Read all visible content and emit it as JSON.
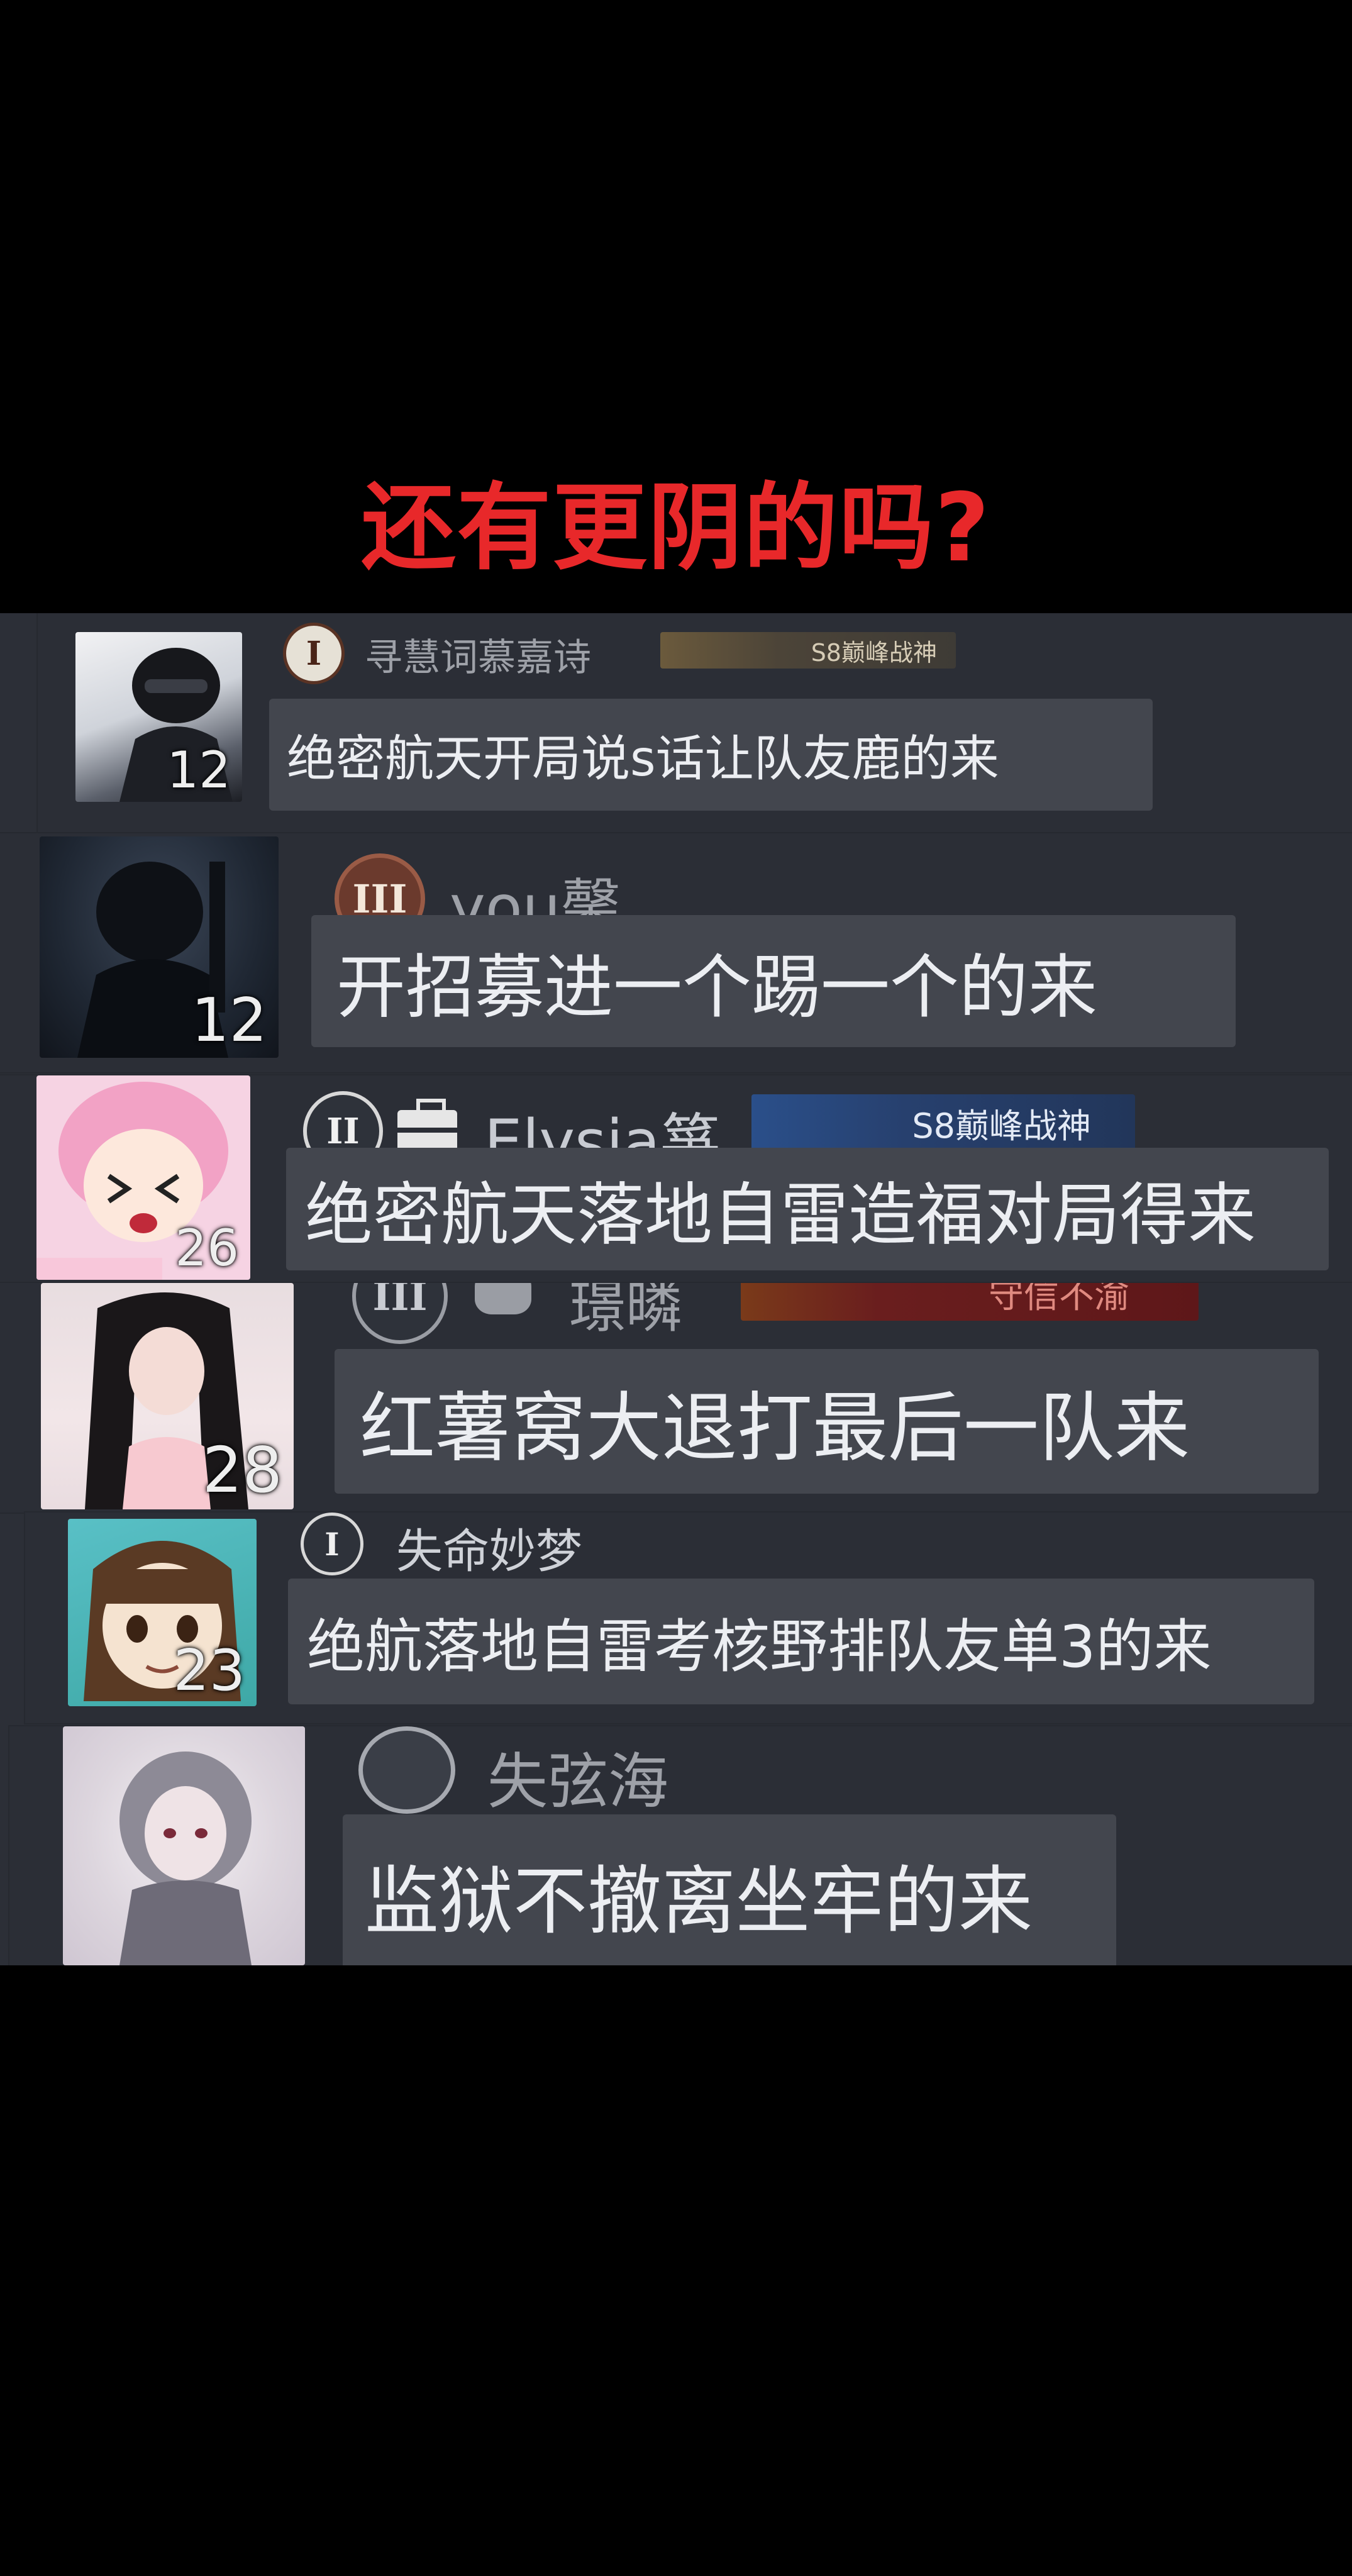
{
  "headline": {
    "text": "还有更阴的吗?",
    "color": "#e8282a"
  },
  "messages": [
    {
      "level": "12",
      "rank_icon": "rank-1-icon",
      "rank": "I",
      "name": "寻慧词慕嘉诗",
      "tag": "S8巅峰战神",
      "text": "绝密航天开局说s话让队友鹿的来"
    },
    {
      "level": "12",
      "rank_icon": "rank-3-icon",
      "rank": "III",
      "name": "you馨",
      "tag": "",
      "text": "开招募进一个踢一个的来"
    },
    {
      "level": "26",
      "rank_icon": "rank-2-icon",
      "rank": "II",
      "name": "Elysia箏",
      "tag": "S8巅峰战神",
      "text": "绝密航天落地自雷造福对局得来"
    },
    {
      "level": "28",
      "rank_icon": "rank-3-icon",
      "rank": "III",
      "name": "璟暽",
      "tag": "守信不渝",
      "text": "红薯窝大退打最后一队来"
    },
    {
      "level": "23",
      "rank_icon": "rank-1-icon",
      "rank": "I",
      "name": "失命妙梦",
      "tag": "",
      "text": "绝航落地自雷考核野排队友单3的来"
    },
    {
      "level": "",
      "rank_icon": "rank-special-icon",
      "rank": "",
      "name": "失弦海",
      "tag": "",
      "text": "监狱不撤离坐牢的来"
    }
  ]
}
